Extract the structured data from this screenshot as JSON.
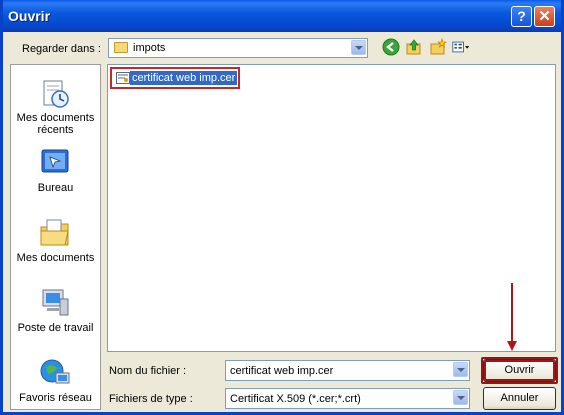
{
  "window": {
    "title": "Ouvrir"
  },
  "titlebar_buttons": {
    "help": "?",
    "close": "✕"
  },
  "lookin": {
    "label": "Regarder dans :",
    "value": "impots"
  },
  "toolbar_icons": [
    "back-icon",
    "up-folder-icon",
    "new-folder-icon",
    "views-menu-icon"
  ],
  "places": [
    {
      "label": "Mes documents récents",
      "icon": "recent-documents-icon"
    },
    {
      "label": "Bureau",
      "icon": "desktop-icon"
    },
    {
      "label": "Mes documents",
      "icon": "my-documents-icon"
    },
    {
      "label": "Poste de travail",
      "icon": "my-computer-icon"
    },
    {
      "label": "Favoris réseau",
      "icon": "network-places-icon"
    }
  ],
  "files": [
    {
      "name": "certificat web imp.cer",
      "selected": true,
      "icon": "certificate-file-icon"
    }
  ],
  "filename": {
    "label": "Nom du fichier :",
    "value": "certificat web imp.cer"
  },
  "filetype": {
    "label": "Fichiers de type :",
    "value": "Certificat X.509 (*.cer;*.crt)"
  },
  "buttons": {
    "open": "Ouvrir",
    "cancel": "Annuler"
  },
  "colors": {
    "title_bar": "#0a58e0",
    "dialog_bg": "#ece9d8",
    "selection": "#316ac5",
    "highlight_box": "#c62828"
  }
}
